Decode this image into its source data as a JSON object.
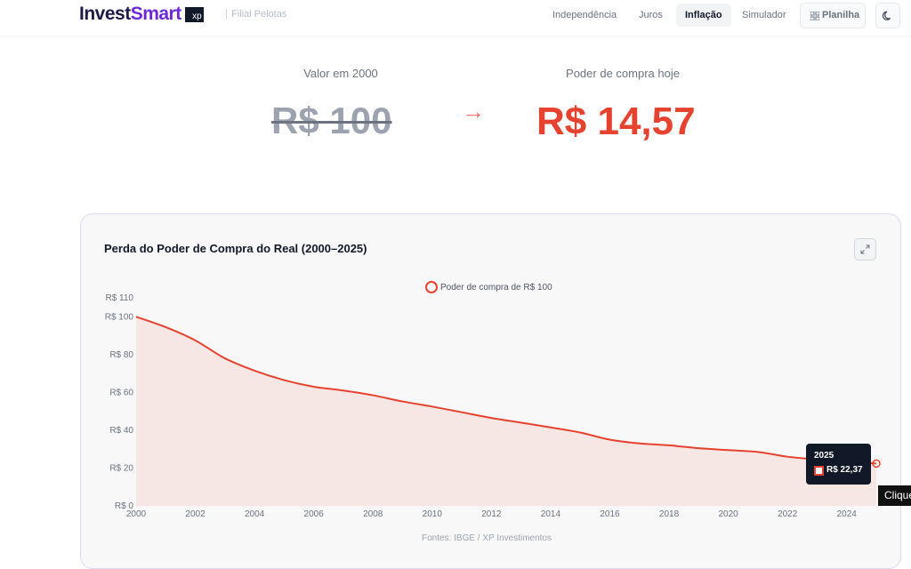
{
  "brand": {
    "part1": "Invest",
    "part2": "Smart",
    "badge": "xp",
    "subtitle": "Filial Pelotas"
  },
  "nav": {
    "items": [
      "Independência",
      "Juros",
      "Inflação",
      "Simulador"
    ],
    "active": "Inflação",
    "planilha_label": "Planilha",
    "grid_icon": "grid-icon",
    "theme_icon": "moon-icon"
  },
  "hero": {
    "left_label": "Valor em 2000",
    "left_value": "R$ 100",
    "right_label": "Poder de compra hoje",
    "right_value": "R$ 14,57",
    "arrow": "→"
  },
  "card": {
    "title": "Perda do Poder de Compra do Real (2000–2025)",
    "expand_icon": "expand-icon",
    "source": "Fontes: IBGE / XP Investimentos"
  },
  "tooltip": {
    "year": "2025",
    "value": "R$ 22,37"
  },
  "clique_label": "Clique",
  "colors": {
    "accent": "#e5432f",
    "brand_purple": "#6d28d9",
    "brand_dark": "#1e1b4b"
  },
  "chart_data": {
    "type": "area",
    "legend": "Poder de compra de R$ 100",
    "legend_position": "top-center",
    "x": [
      2000,
      2001,
      2002,
      2003,
      2004,
      2005,
      2006,
      2007,
      2008,
      2009,
      2010,
      2011,
      2012,
      2013,
      2014,
      2015,
      2016,
      2017,
      2018,
      2019,
      2020,
      2021,
      2022,
      2023,
      2024,
      2025
    ],
    "series": [
      {
        "name": "Poder de compra de R$ 100",
        "values": [
          100,
          94.5,
          87.5,
          78,
          71.5,
          66.5,
          63,
          61,
          58.5,
          55.2,
          52.5,
          49.5,
          46.5,
          44,
          41.5,
          38.8,
          35,
          33,
          32,
          30.5,
          29.5,
          28.5,
          26,
          24.5,
          23.5,
          22.37
        ]
      }
    ],
    "x_ticks": [
      "2000",
      "2002",
      "2004",
      "2006",
      "2008",
      "2010",
      "2012",
      "2014",
      "2016",
      "2018",
      "2020",
      "2022",
      "2024"
    ],
    "y_ticks": [
      "R$ 0",
      "R$ 20",
      "R$ 40",
      "R$ 60",
      "R$ 80",
      "R$ 100",
      "R$ 110"
    ],
    "ylim": [
      0,
      110
    ],
    "xlim": [
      2000,
      2025
    ],
    "grid": false
  }
}
